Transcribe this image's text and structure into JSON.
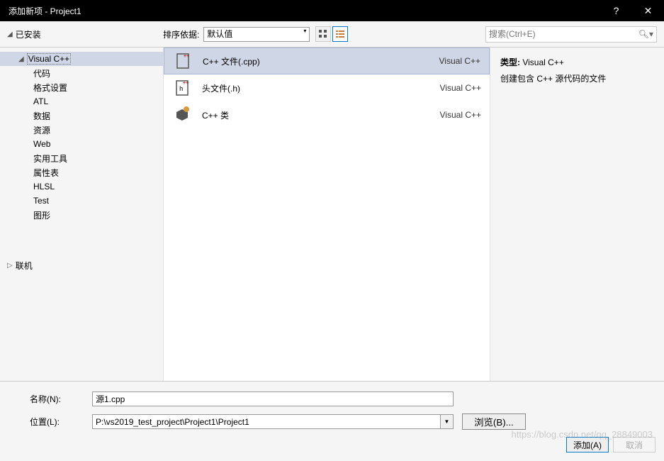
{
  "title": "添加新项 - Project1",
  "titlebar": {
    "help": "?",
    "close": "✕"
  },
  "toolbar": {
    "installed": "已安装",
    "sort_label": "排序依据:",
    "sort_value": "默认值",
    "search_placeholder": "搜索(Ctrl+E)",
    "search_icon": "🔍"
  },
  "tree": {
    "root_label": "Visual C++",
    "items": [
      "代码",
      "格式设置",
      "ATL",
      "数据",
      "资源",
      "Web",
      "实用工具",
      "属性表",
      "HLSL",
      "Test",
      "图形"
    ],
    "online": "联机"
  },
  "templates": [
    {
      "label": "C++ 文件(.cpp)",
      "lang": "Visual C++",
      "selected": true,
      "icon": "cpp"
    },
    {
      "label": "头文件(.h)",
      "lang": "Visual C++",
      "selected": false,
      "icon": "h"
    },
    {
      "label": "C++ 类",
      "lang": "Visual C++",
      "selected": false,
      "icon": "class"
    }
  ],
  "details": {
    "type_label": "类型:",
    "type_value": "Visual C++",
    "description": "创建包含 C++ 源代码的文件"
  },
  "form": {
    "name_label": "名称(N):",
    "name_value": "源1.cpp",
    "location_label": "位置(L):",
    "location_value": "P:\\vs2019_test_project\\Project1\\Project1",
    "browse_label": "浏览(B)..."
  },
  "buttons": {
    "add": "添加(A)",
    "cancel": "取消"
  },
  "watermark": "https://blog.csdn.net/qq_28849003"
}
